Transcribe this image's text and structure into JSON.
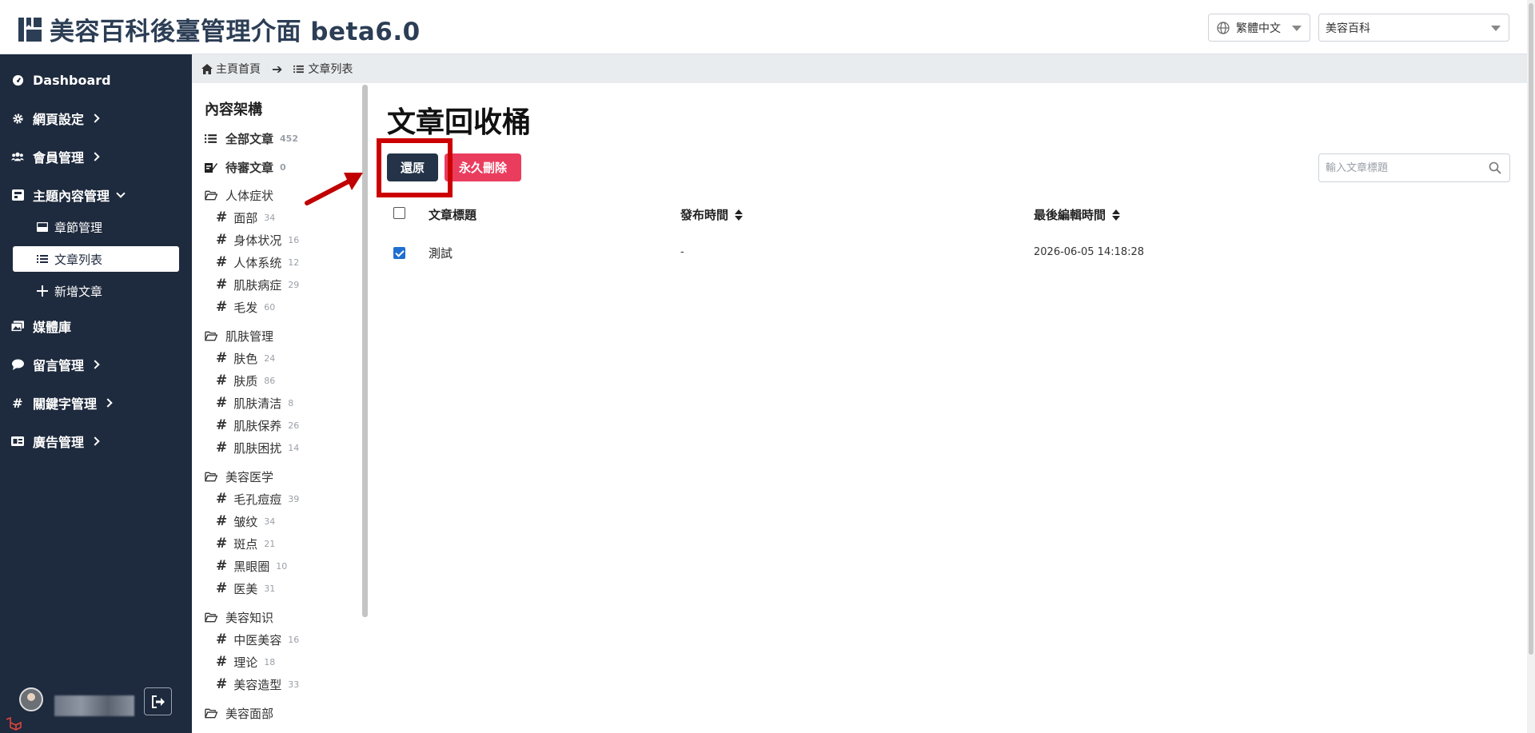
{
  "header": {
    "title": "美容百科後臺管理介面 beta6.0",
    "language": "繁體中文",
    "site": "美容百科"
  },
  "sidebar": {
    "items": [
      {
        "label": "Dashboard",
        "icon": "gauge-icon"
      },
      {
        "label": "網頁設定",
        "icon": "gear-icon"
      },
      {
        "label": "會員管理",
        "icon": "users-icon"
      },
      {
        "label": "主題內容管理",
        "icon": "book-icon"
      },
      {
        "label": "媒體庫",
        "icon": "images-icon"
      },
      {
        "label": "留言管理",
        "icon": "comment-icon"
      },
      {
        "label": "關鍵字管理",
        "icon": "hashtag-icon"
      },
      {
        "label": "廣告管理",
        "icon": "ad-icon"
      }
    ],
    "sub_items": [
      {
        "label": "章節管理",
        "icon": "hdd-icon"
      },
      {
        "label": "文章列表",
        "icon": "list-icon"
      },
      {
        "label": "新增文章",
        "icon": "plus-icon"
      }
    ]
  },
  "breadcrumb": {
    "home": "主頁首頁",
    "current": "文章列表"
  },
  "tree": {
    "title": "內容架構",
    "all": {
      "label": "全部文章",
      "count": "452"
    },
    "pending": {
      "label": "待審文章",
      "count": "0"
    },
    "groups": [
      {
        "label": "人体症状",
        "items": [
          {
            "label": "面部",
            "count": "34"
          },
          {
            "label": "身体状况",
            "count": "16"
          },
          {
            "label": "人体系统",
            "count": "12"
          },
          {
            "label": "肌肤病症",
            "count": "29"
          },
          {
            "label": "毛发",
            "count": "60"
          }
        ]
      },
      {
        "label": "肌肤管理",
        "items": [
          {
            "label": "肤色",
            "count": "24"
          },
          {
            "label": "肤质",
            "count": "86"
          },
          {
            "label": "肌肤清洁",
            "count": "8"
          },
          {
            "label": "肌肤保养",
            "count": "26"
          },
          {
            "label": "肌肤困扰",
            "count": "14"
          }
        ]
      },
      {
        "label": "美容医学",
        "items": [
          {
            "label": "毛孔痘痘",
            "count": "39"
          },
          {
            "label": "皱纹",
            "count": "34"
          },
          {
            "label": "斑点",
            "count": "21"
          },
          {
            "label": "黑眼圈",
            "count": "10"
          },
          {
            "label": "医美",
            "count": "31"
          }
        ]
      },
      {
        "label": "美容知识",
        "items": [
          {
            "label": "中医美容",
            "count": "16"
          },
          {
            "label": "理论",
            "count": "18"
          },
          {
            "label": "美容造型",
            "count": "33"
          }
        ]
      },
      {
        "label": "美容面部",
        "items": []
      }
    ]
  },
  "main": {
    "title": "文章回收桶",
    "restore_label": "還原",
    "delete_label": "永久刪除",
    "search_placeholder": "輸入文章標題",
    "columns": [
      "文章標題",
      "發布時間",
      "最後編輯時間"
    ],
    "rows": [
      {
        "title": "測試",
        "published": "-",
        "edited": "2026-06-05 14:18:28",
        "checked": true
      }
    ]
  },
  "colors": {
    "sidebar_bg": "#1e2a3d",
    "restore_btn": "#243347",
    "delete_btn": "#ea3d5e",
    "highlight": "#cc0000"
  }
}
